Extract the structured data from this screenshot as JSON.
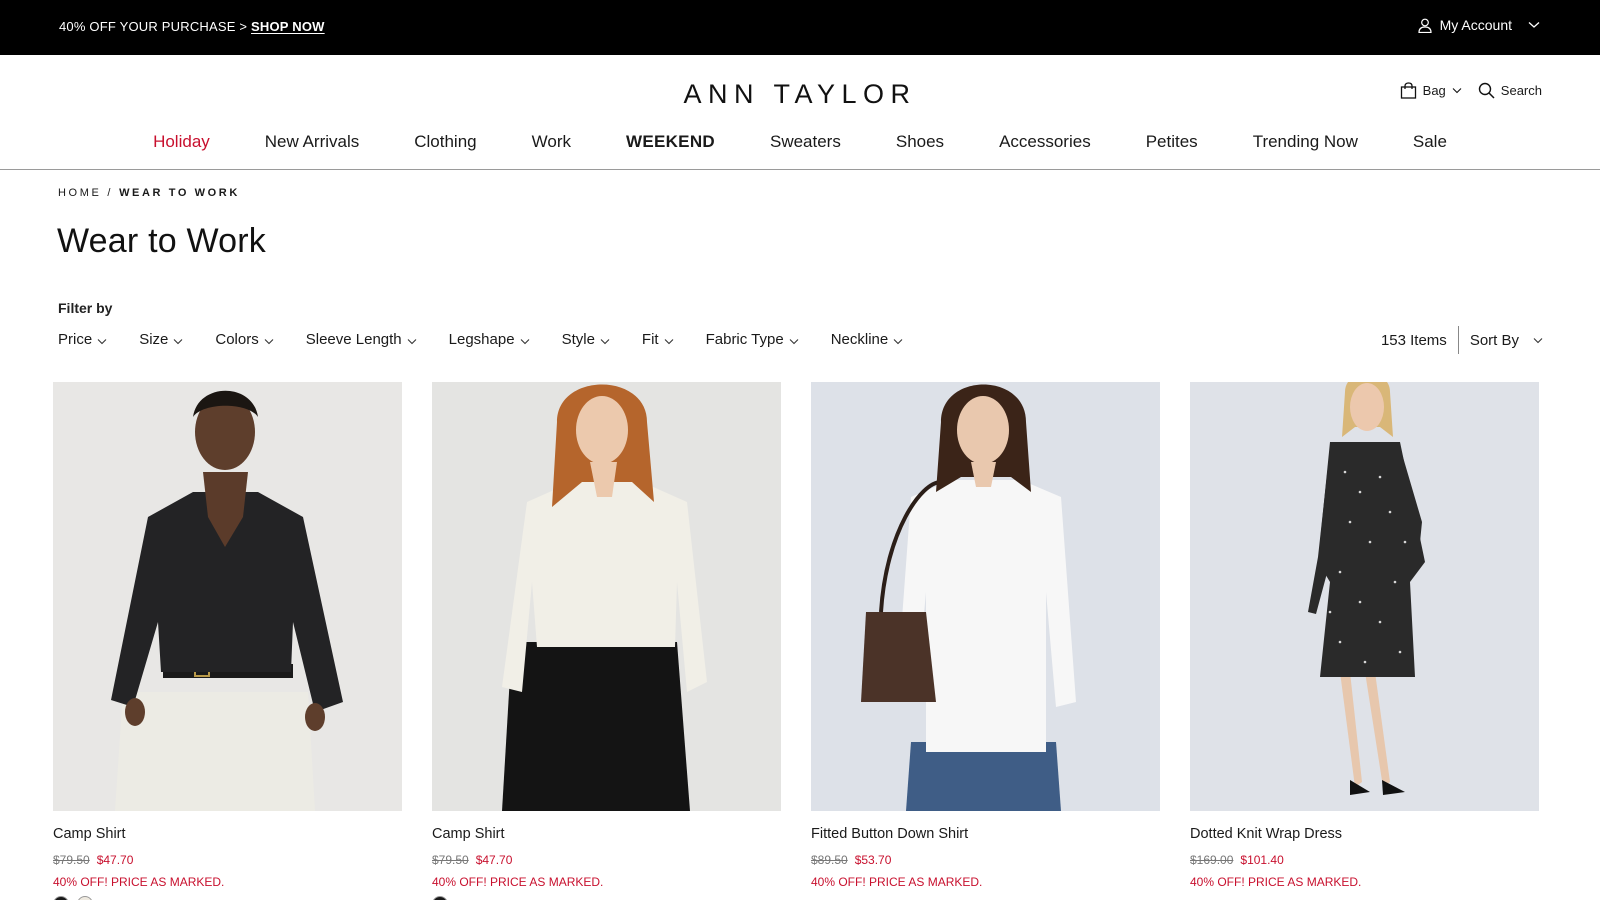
{
  "promo": {
    "text": "40% OFF YOUR PURCHASE > ",
    "link": "SHOP NOW"
  },
  "account": {
    "label": "My Account"
  },
  "header": {
    "logo": "ANN TAYLOR",
    "bag_label": "Bag",
    "search_label": "Search"
  },
  "nav": {
    "items": [
      "Holiday",
      "New Arrivals",
      "Clothing",
      "Work",
      "WEEKEND",
      "Sweaters",
      "Shoes",
      "Accessories",
      "Petites",
      "Trending Now",
      "Sale"
    ]
  },
  "breadcrumb": {
    "home": "HOME",
    "sep": "/",
    "current": "WEAR TO WORK"
  },
  "page": {
    "title": "Wear to Work"
  },
  "filters": {
    "label": "Filter by",
    "items": [
      "Price",
      "Size",
      "Colors",
      "Sleeve Length",
      "Legshape",
      "Style",
      "Fit",
      "Fabric Type",
      "Neckline"
    ],
    "count": "153 Items",
    "sort_label": "Sort By"
  },
  "products": [
    {
      "name": "Camp Shirt",
      "old_price": "$79.50",
      "new_price": "$47.70",
      "note": "40% OFF! PRICE AS MARKED.",
      "swatches": [
        "#1a1a1a",
        "#efeae0"
      ]
    },
    {
      "name": "Camp Shirt",
      "old_price": "$79.50",
      "new_price": "$47.70",
      "note": "40% OFF! PRICE AS MARKED.",
      "swatches": [
        "#1a1a1a"
      ]
    },
    {
      "name": "Fitted Button Down Shirt",
      "old_price": "$89.50",
      "new_price": "$53.70",
      "note": "40% OFF! PRICE AS MARKED.",
      "swatches": []
    },
    {
      "name": "Dotted Knit Wrap Dress",
      "old_price": "$169.00",
      "new_price": "$101.40",
      "note": "40% OFF! PRICE AS MARKED.",
      "swatches": []
    }
  ],
  "colors": {
    "accent_red": "#c8102e",
    "promo_bg": "#000000"
  },
  "icons": {
    "account": "user-icon",
    "bag": "shopping-bag-icon",
    "search": "search-icon",
    "chevron": "chevron-down-icon"
  }
}
